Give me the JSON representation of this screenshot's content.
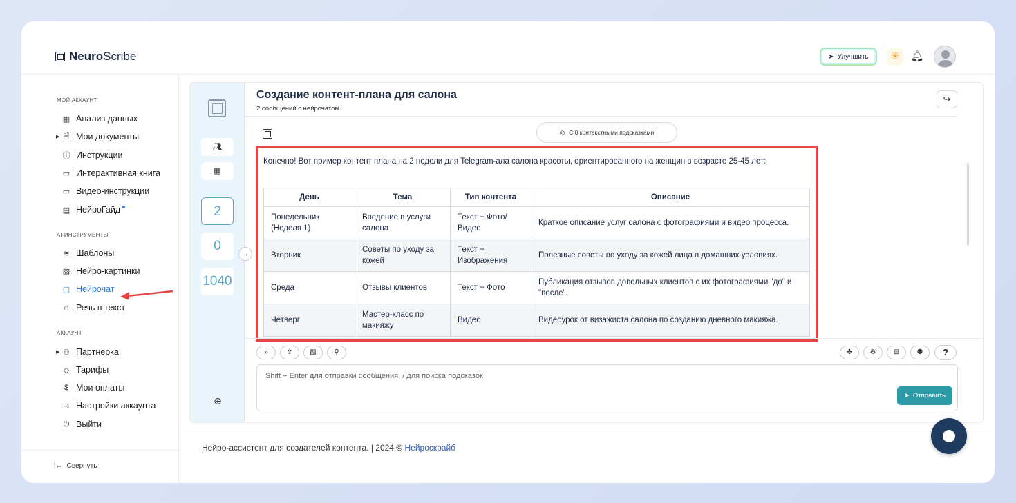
{
  "app": {
    "brand_bold": "Neuro",
    "brand_light": "Scribe"
  },
  "header": {
    "upgrade_label": "Улучшить"
  },
  "sidebar": {
    "section_account": "МОЙ АККАУНТ",
    "account_items": [
      {
        "label": "Анализ данных",
        "icon": "grid-icon"
      },
      {
        "label": "Мои документы",
        "icon": "document-icon"
      },
      {
        "label": "Инструкции",
        "icon": "help-circle-icon"
      },
      {
        "label": "Интерактивная книга",
        "icon": "book-icon"
      },
      {
        "label": "Видео-инструкции",
        "icon": "video-icon"
      },
      {
        "label": "НейроГайд",
        "icon": "guide-icon"
      }
    ],
    "section_ai": "AI-ИНСТРУМЕНТЫ",
    "ai_items": [
      {
        "label": "Шаблоны",
        "icon": "layers-icon"
      },
      {
        "label": "Нейро-картинки",
        "icon": "image-icon"
      },
      {
        "label": "Нейрочат",
        "icon": "chat-icon",
        "active": true
      },
      {
        "label": "Речь в текст",
        "icon": "headphones-icon"
      }
    ],
    "section_acc2": "АККАУНТ",
    "acc_items": [
      {
        "label": "Партнерка",
        "icon": "users-icon"
      },
      {
        "label": "Тарифы",
        "icon": "tag-icon"
      },
      {
        "label": "Мои оплаты",
        "icon": "dollar-icon"
      },
      {
        "label": "Настройки аккаунта",
        "icon": "login-icon"
      },
      {
        "label": "Выйти",
        "icon": "power-icon"
      }
    ],
    "collapse_label": "Свернуть"
  },
  "rail": {
    "counts": [
      "2",
      "0",
      "1040"
    ]
  },
  "chat": {
    "title": "Создание контент-плана для салона",
    "subtitle": "2 сообщений с нейрочатом",
    "hints_label": "С 0 контекстными подсказками",
    "intro": "Конечно! Вот пример контент плана на 2 недели для Telegram-ала салона красоты, ориентированного на женщин в возрасте 25-45 лет:",
    "table": {
      "headers": [
        "День",
        "Тема",
        "Тип контента",
        "Описание"
      ],
      "rows": [
        [
          "Понедельник (Неделя 1)",
          "Введение в услуги салона",
          "Текст + Фото/ Видео",
          "Краткое описание услуг салона с фотографиями и видео процесса."
        ],
        [
          "Вторник",
          "Советы по уходу за кожей",
          "Текст + Изображения",
          "Полезные советы по уходу за кожей лица в домашних условиях."
        ],
        [
          "Среда",
          "Отзывы клиентов",
          "Текст + Фото",
          "Публикация отзывов довольных клиентов с их фотографиями \"до\" и \"после\"."
        ],
        [
          "Четверг",
          "Мастер-класс по макияжу",
          "Видео",
          "Видеоурок от визажиста салона по созданию дневного макияжа."
        ]
      ]
    },
    "input_placeholder": "Shift + Enter для отправки сообщения, / для поиска подсказок",
    "send_label": "Отправить",
    "help_label": "?"
  },
  "footer": {
    "text": "Нейро-ассистент для создателей контента.  | 2024 © ",
    "link": "Нейроскрайб"
  },
  "colors": {
    "accent": "#2c9aa6",
    "highlight": "#e84545",
    "active": "#2f7fe0"
  }
}
